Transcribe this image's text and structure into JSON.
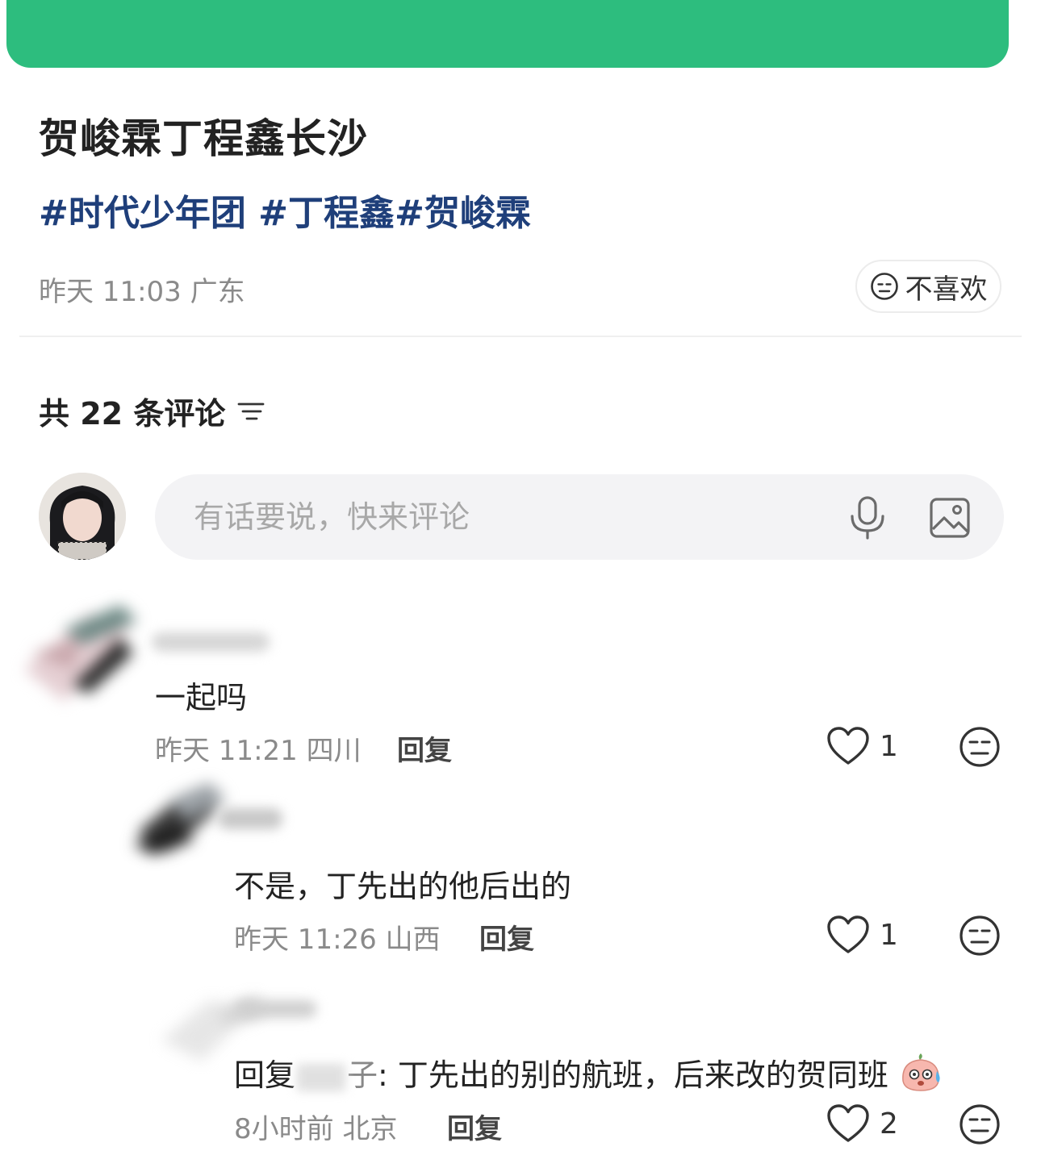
{
  "post": {
    "title": "贺峻霖丁程鑫长沙",
    "tags": "#时代少年团 #丁程鑫#贺峻霖",
    "time": "昨天 11:03",
    "location": "广东",
    "dislike_label": "不喜欢"
  },
  "comments_header": {
    "count_label": "共 22 条评论"
  },
  "comment_input": {
    "placeholder": "有话要说，快来评论"
  },
  "comments": [
    {
      "text": "一起吗",
      "time": "昨天 11:21",
      "location": "四川",
      "reply_label": "回复",
      "likes": "1"
    },
    {
      "text": "不是，丁先出的他后出的",
      "time": "昨天 11:26",
      "location": "山西",
      "reply_label": "回复",
      "likes": "1"
    },
    {
      "reply_prefix": "回复",
      "reply_name_tail": "子",
      "text": ": 丁先出的别的航班，后来改的贺同班",
      "time": "8小时前",
      "location": "北京",
      "reply_label": "回复",
      "likes": "2"
    }
  ],
  "icons": {
    "dislike": "neutral-face-icon",
    "sort": "sort-lines-icon",
    "mic": "microphone-icon",
    "image": "image-icon",
    "like": "heart-outline-icon",
    "emoji": "sweat-emoji-icon"
  },
  "colors": {
    "top_bar": "#2dbd7e",
    "tag": "#1f3f7a",
    "meta": "#8a8a8a"
  }
}
